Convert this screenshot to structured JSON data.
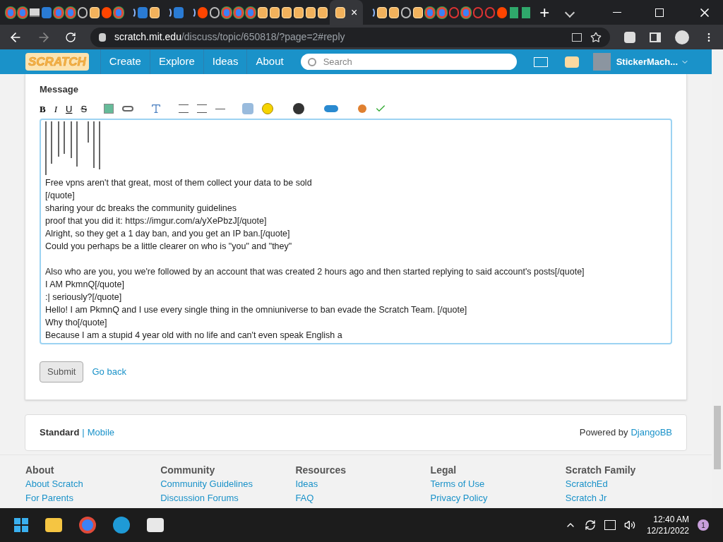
{
  "browser": {
    "tabs": [
      {
        "kind": "chrome",
        "selected": false
      },
      {
        "kind": "chrome",
        "selected": false
      },
      {
        "kind": "monitor",
        "selected": false
      },
      {
        "kind": "blue",
        "selected": false
      },
      {
        "kind": "chrome",
        "selected": false
      },
      {
        "kind": "chrome",
        "selected": false
      },
      {
        "kind": "grey",
        "selected": false
      },
      {
        "kind": "scratch",
        "selected": false
      },
      {
        "kind": "reddit",
        "selected": false
      },
      {
        "kind": "chrome",
        "selected": false
      },
      {
        "kind": "loading",
        "selected": false
      },
      {
        "kind": "blue",
        "selected": false
      },
      {
        "kind": "scratch",
        "selected": false
      },
      {
        "kind": "loading",
        "selected": false
      },
      {
        "kind": "blue",
        "selected": false
      },
      {
        "kind": "loading",
        "selected": false
      },
      {
        "kind": "reddit",
        "selected": false
      },
      {
        "kind": "grey",
        "selected": false
      },
      {
        "kind": "chrome",
        "selected": false
      },
      {
        "kind": "chrome",
        "selected": false
      },
      {
        "kind": "chrome",
        "selected": false
      },
      {
        "kind": "scratch",
        "selected": false
      },
      {
        "kind": "scratch",
        "selected": false
      },
      {
        "kind": "scratch",
        "selected": false
      },
      {
        "kind": "scratch",
        "selected": false
      },
      {
        "kind": "scratch",
        "selected": false
      },
      {
        "kind": "scratch",
        "selected": false
      },
      {
        "kind": "scratch",
        "selected": true
      },
      {
        "kind": "loading",
        "selected": false
      },
      {
        "kind": "scratch",
        "selected": false
      },
      {
        "kind": "scratch",
        "selected": false
      },
      {
        "kind": "grey",
        "selected": false
      },
      {
        "kind": "scratch",
        "selected": false
      },
      {
        "kind": "chrome",
        "selected": false
      },
      {
        "kind": "chrome",
        "selected": false
      },
      {
        "kind": "red",
        "selected": false
      },
      {
        "kind": "chrome",
        "selected": false
      },
      {
        "kind": "red",
        "selected": false
      },
      {
        "kind": "red",
        "selected": false
      },
      {
        "kind": "reddit",
        "selected": false
      },
      {
        "kind": "green",
        "selected": false
      },
      {
        "kind": "green",
        "selected": false
      }
    ],
    "new_tab": "+",
    "active_tab_close": "×",
    "url_host": "scratch.mit.edu",
    "url_path": "/discuss/topic/650818/?page=2#reply"
  },
  "nav": {
    "logo": "SCRATCH",
    "links": [
      "Create",
      "Explore",
      "Ideas",
      "About"
    ],
    "search": {
      "placeholder": "Search"
    },
    "username": "StickerMach..."
  },
  "form": {
    "label": "Message",
    "format_buttons": [
      "B",
      "I",
      "U",
      "S"
    ],
    "message_paragraphs": [
      [
        "Free vpns aren't that great, most of them collect your data to be sold",
        "[/quote]",
        "sharing your dc breaks the community guidelines",
        "proof that you did it: https://imgur.com/a/yXePbzJ[/quote]",
        "Alright, so they get a 1 day ban, and you get an IP ban.[/quote]",
        "Could you perhaps be a little clearer on who is \"you\" and \"they\""
      ],
      [
        "Also who are you, you we're followed by an account that was created 2 hours ago and then started replying to said account's posts[/quote]",
        "I AM PkmnQ[/quote]",
        ":| seriously?[/quote]",
        "Hello! I am PkmnQ and I use every single thing in the omniuniverse to ban evade the Scratch Team. [/quote]",
        "Why tho[/quote]",
        "Because I am a stupid 4 year old with no life and can't even speak English a"
      ]
    ],
    "submit": "Submit",
    "back": "Go back"
  },
  "footer_bar": {
    "standard": "Standard",
    "separator": "|",
    "mobile": "Mobile",
    "powered": "Powered by",
    "django": "DjangoBB"
  },
  "footer": {
    "columns": [
      {
        "title": "About",
        "links": [
          "About Scratch",
          "For Parents"
        ]
      },
      {
        "title": "Community",
        "links": [
          "Community Guidelines",
          "Discussion Forums"
        ]
      },
      {
        "title": "Resources",
        "links": [
          "Ideas",
          "FAQ"
        ]
      },
      {
        "title": "Legal",
        "links": [
          "Terms of Use",
          "Privacy Policy"
        ]
      },
      {
        "title": "Scratch Family",
        "links": [
          "ScratchEd",
          "Scratch Jr"
        ]
      }
    ]
  },
  "taskbar": {
    "time": "12:40 AM",
    "date": "12/21/2022",
    "badge": "1"
  }
}
